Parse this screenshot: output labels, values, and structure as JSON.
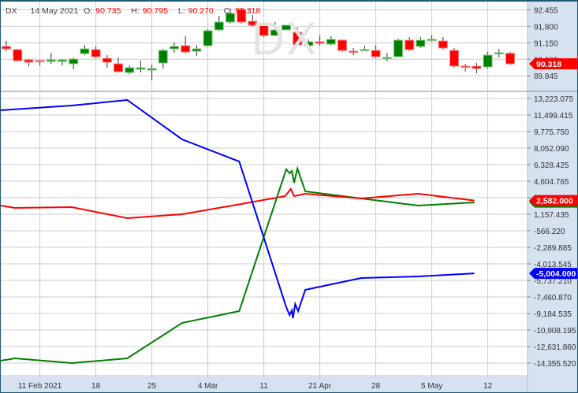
{
  "symbol": "DX",
  "legend": {
    "date": "14 May 2021",
    "o_label": "O:",
    "o": "90.735",
    "h_label": "H:",
    "h": "90.795",
    "l_label": "L:",
    "l": "90.270",
    "c_label": "C:",
    "c": "90.318"
  },
  "watermark": "DX",
  "colors": {
    "up": "#008000",
    "down": "#ff0000",
    "blue": "#0000ff",
    "axis_bg": "#d6e2ef",
    "grid": "#cccccc",
    "frame": "#1e5a74"
  },
  "chart_data": [
    {
      "type": "candlestick",
      "title": "DX",
      "x_unit": "bar index",
      "yticks": [
        "92.455",
        "91.800",
        "91.150",
        "90.500",
        "89.845"
      ],
      "ylim": [
        89.845,
        92.455
      ],
      "last_price_tag": "90.318",
      "ohlc": [
        [
          91.005,
          91.223,
          90.817,
          90.911
        ],
        [
          90.88,
          90.911,
          90.412,
          90.443
        ],
        [
          90.474,
          90.506,
          90.225,
          90.381
        ],
        [
          90.443,
          90.474,
          90.256,
          90.412
        ],
        [
          90.412,
          90.755,
          90.318,
          90.474
        ],
        [
          90.412,
          90.506,
          90.256,
          90.474
        ],
        [
          90.318,
          90.568,
          90.1,
          90.506
        ],
        [
          90.724,
          91.067,
          90.662,
          90.911
        ],
        [
          90.88,
          91.005,
          90.537,
          90.599
        ],
        [
          90.537,
          90.662,
          90.163,
          90.381
        ],
        [
          90.318,
          90.568,
          89.975,
          90.007
        ],
        [
          89.975,
          90.256,
          89.913,
          90.163
        ],
        [
          90.1,
          90.443,
          89.975,
          90.163
        ],
        [
          90.069,
          90.287,
          89.663,
          90.131
        ],
        [
          90.35,
          90.911,
          90.131,
          90.849
        ],
        [
          90.911,
          91.161,
          90.755,
          91.005
        ],
        [
          91.036,
          91.41,
          90.724,
          90.786
        ],
        [
          90.817,
          91.067,
          90.63,
          90.911
        ],
        [
          91.036,
          91.691,
          91.005,
          91.628
        ],
        [
          91.66,
          92.221,
          91.628,
          91.972
        ],
        [
          91.972,
          92.502,
          91.909,
          92.315
        ],
        [
          92.471,
          92.533,
          91.909,
          91.972
        ],
        [
          92.003,
          92.252,
          91.784,
          91.847
        ],
        [
          91.847,
          91.878,
          91.379,
          91.441
        ],
        [
          91.441,
          91.972,
          91.41,
          91.66
        ],
        [
          91.66,
          91.847,
          91.66,
          91.847
        ],
        [
          91.566,
          91.753,
          91.036,
          91.067
        ],
        [
          91.036,
          91.285,
          90.849,
          91.192
        ],
        [
          91.192,
          91.441,
          91.036,
          91.129
        ],
        [
          91.098,
          91.41,
          91.036,
          91.285
        ],
        [
          91.254,
          91.285,
          90.786,
          90.849
        ],
        [
          90.817,
          90.942,
          90.662,
          90.786
        ],
        [
          90.849,
          91.036,
          90.817,
          90.88
        ],
        [
          90.849,
          91.067,
          90.537,
          90.599
        ],
        [
          90.537,
          90.755,
          90.412,
          90.568
        ],
        [
          90.599,
          91.317,
          90.599,
          91.254
        ],
        [
          91.254,
          91.379,
          90.817,
          90.88
        ],
        [
          91.005,
          91.379,
          90.942,
          91.254
        ],
        [
          91.254,
          91.441,
          91.192,
          91.285
        ],
        [
          91.223,
          91.379,
          90.88,
          90.942
        ],
        [
          90.849,
          90.942,
          90.163,
          90.225
        ],
        [
          90.225,
          90.318,
          90.007,
          90.194
        ],
        [
          90.225,
          90.35,
          89.944,
          90.131
        ],
        [
          90.194,
          90.786,
          90.131,
          90.662
        ],
        [
          90.724,
          90.911,
          90.568,
          90.755
        ],
        [
          90.735,
          90.795,
          90.27,
          90.318
        ]
      ]
    },
    {
      "type": "line",
      "x_unit": "bar index",
      "yticks": [
        "13,223.075",
        "11,499.415",
        "9,775.750",
        "8,052.090",
        "6,328.425",
        "4,604.765",
        "2,881.100",
        "1,157.435",
        "-566.220",
        "-2,289.885",
        "-4,013.545",
        "-5,737.210",
        "-7,460.870",
        "-9,184.535",
        "-10,908.195",
        "-12,631.860",
        "-14,355.520"
      ],
      "ylim": [
        -14355.52,
        13223.075
      ],
      "series": [
        {
          "name": "blue",
          "color": "#0000ff",
          "last_tag": "-5,004.000",
          "points": [
            [
              -0.5,
              11992
            ],
            [
              5.85,
              12484
            ],
            [
              10.8,
              13059
            ],
            [
              15.7,
              8955
            ],
            [
              20.8,
              6656
            ],
            [
              25.0,
              -8529
            ],
            [
              25.3,
              -9349
            ],
            [
              25.5,
              -8857
            ],
            [
              25.6,
              -9677
            ],
            [
              25.8,
              -8201
            ],
            [
              26.06,
              -8939
            ],
            [
              26.7,
              -6723
            ],
            [
              31.7,
              -5491
            ],
            [
              36.8,
              -5327
            ],
            [
              41.8,
              -5004
            ]
          ]
        },
        {
          "name": "red",
          "color": "#ff0000",
          "last_tag": "2,582.000",
          "points": [
            [
              -0.5,
              2060
            ],
            [
              0.77,
              1814
            ],
            [
              5.85,
              1896
            ],
            [
              10.8,
              747
            ],
            [
              15.7,
              1157
            ],
            [
              20.6,
              2142
            ],
            [
              24.9,
              3045
            ],
            [
              25.4,
              3783
            ],
            [
              25.7,
              3045
            ],
            [
              26.7,
              3290
            ],
            [
              31.7,
              2798
            ],
            [
              36.8,
              3290
            ],
            [
              41.8,
              2582
            ]
          ]
        },
        {
          "name": "green",
          "color": "#008000",
          "points": [
            [
              -0.5,
              -14110
            ],
            [
              0.77,
              -13864
            ],
            [
              5.85,
              -14356
            ],
            [
              10.8,
              -13864
            ],
            [
              15.7,
              -10170
            ],
            [
              20.8,
              -8939
            ],
            [
              25.0,
              5836
            ],
            [
              25.3,
              5425
            ],
            [
              25.5,
              5672
            ],
            [
              25.7,
              4441
            ],
            [
              26.0,
              5918
            ],
            [
              26.7,
              3537
            ],
            [
              31.7,
              2798
            ],
            [
              36.8,
              2060
            ],
            [
              41.8,
              2388
            ]
          ]
        }
      ]
    }
  ],
  "xticks": [
    {
      "index": 3,
      "label": "11 Feb 2021"
    },
    {
      "index": 8,
      "label": "18"
    },
    {
      "index": 13,
      "label": "25"
    },
    {
      "index": 18,
      "label": "4 Mar"
    },
    {
      "index": 23,
      "label": "11"
    },
    {
      "index": 28,
      "label": "21 Apr"
    },
    {
      "index": 33,
      "label": "28"
    },
    {
      "index": 38,
      "label": "5 May"
    },
    {
      "index": 43,
      "label": "12"
    }
  ]
}
